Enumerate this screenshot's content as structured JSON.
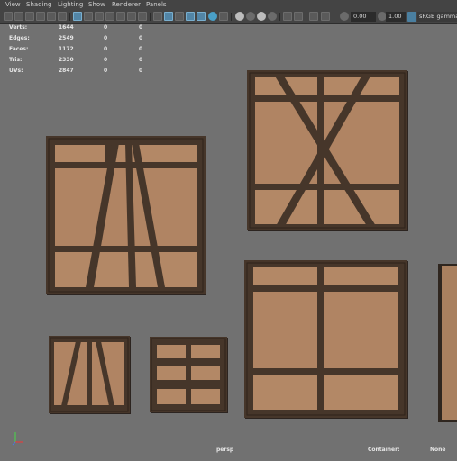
{
  "menu": {
    "items": [
      "View",
      "Shading",
      "Lighting",
      "Show",
      "Renderer",
      "Panels"
    ]
  },
  "toolbar": {
    "field1": "0.00",
    "field2": "1.00",
    "color_space_label": "sRGB gamma"
  },
  "hud": {
    "rows": [
      {
        "label": "Verts:",
        "v1": "1644",
        "v2": "0",
        "v3": "0"
      },
      {
        "label": "Edges:",
        "v1": "2549",
        "v2": "0",
        "v3": "0"
      },
      {
        "label": "Faces:",
        "v1": "1172",
        "v2": "0",
        "v3": "0"
      },
      {
        "label": "Tris:",
        "v1": "2330",
        "v2": "0",
        "v3": "0"
      },
      {
        "label": "UVs:",
        "v1": "2847",
        "v2": "0",
        "v3": "0"
      }
    ],
    "camera": "persp",
    "container_label": "Container:",
    "container_value": "None"
  },
  "colors": {
    "viewport_bg": "#717171",
    "plaster": "#b38866",
    "timber": "#46362a",
    "active_tool": "#5285a6"
  }
}
